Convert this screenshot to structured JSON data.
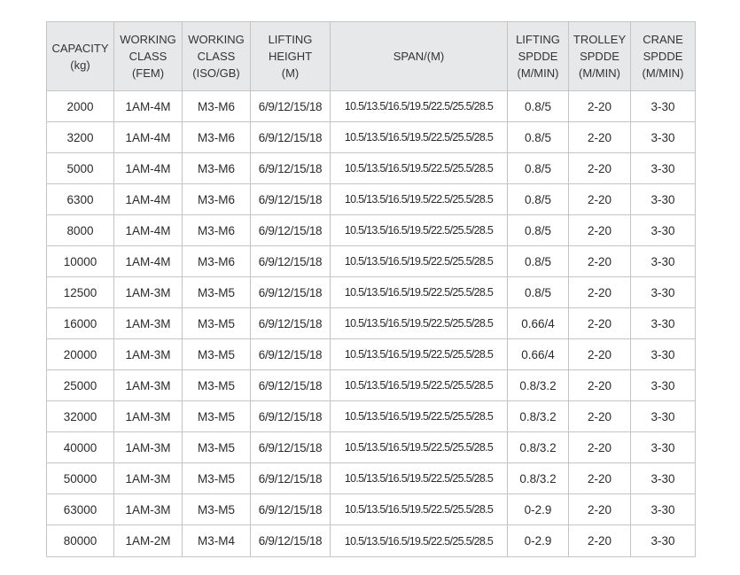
{
  "table": {
    "headers": [
      [
        "CAPACITY",
        "(kg)"
      ],
      [
        "WORKING",
        "CLASS",
        "(FEM)"
      ],
      [
        "WORKING",
        "CLASS",
        "(ISO/GB)"
      ],
      [
        "LIFTING",
        "HEIGHT",
        "(M)"
      ],
      [
        "SPAN/(M)"
      ],
      [
        "LIFTING",
        "SPDDE",
        "(M/MIN)"
      ],
      [
        "TROLLEY",
        "SPDDE",
        "(M/MIN)"
      ],
      [
        "CRANE",
        "SPDDE",
        "(M/MIN)"
      ]
    ],
    "rows": [
      [
        "2000",
        "1AM-4M",
        "M3-M6",
        "6/9/12/15/18",
        "10.5/13.5/16.5/19.5/22.5/25.5/28.5",
        "0.8/5",
        "2-20",
        "3-30"
      ],
      [
        "3200",
        "1AM-4M",
        "M3-M6",
        "6/9/12/15/18",
        "10.5/13.5/16.5/19.5/22.5/25.5/28.5",
        "0.8/5",
        "2-20",
        "3-30"
      ],
      [
        "5000",
        "1AM-4M",
        "M3-M6",
        "6/9/12/15/18",
        "10.5/13.5/16.5/19.5/22.5/25.5/28.5",
        "0.8/5",
        "2-20",
        "3-30"
      ],
      [
        "6300",
        "1AM-4M",
        "M3-M6",
        "6/9/12/15/18",
        "10.5/13.5/16.5/19.5/22.5/25.5/28.5",
        "0.8/5",
        "2-20",
        "3-30"
      ],
      [
        "8000",
        "1AM-4M",
        "M3-M6",
        "6/9/12/15/18",
        "10.5/13.5/16.5/19.5/22.5/25.5/28.5",
        "0.8/5",
        "2-20",
        "3-30"
      ],
      [
        "10000",
        "1AM-4M",
        "M3-M6",
        "6/9/12/15/18",
        "10.5/13.5/16.5/19.5/22.5/25.5/28.5",
        "0.8/5",
        "2-20",
        "3-30"
      ],
      [
        "12500",
        "1AM-3M",
        "M3-M5",
        "6/9/12/15/18",
        "10.5/13.5/16.5/19.5/22.5/25.5/28.5",
        "0.8/5",
        "2-20",
        "3-30"
      ],
      [
        "16000",
        "1AM-3M",
        "M3-M5",
        "6/9/12/15/18",
        "10.5/13.5/16.5/19.5/22.5/25.5/28.5",
        "0.66/4",
        "2-20",
        "3-30"
      ],
      [
        "20000",
        "1AM-3M",
        "M3-M5",
        "6/9/12/15/18",
        "10.5/13.5/16.5/19.5/22.5/25.5/28.5",
        "0.66/4",
        "2-20",
        "3-30"
      ],
      [
        "25000",
        "1AM-3M",
        "M3-M5",
        "6/9/12/15/18",
        "10.5/13.5/16.5/19.5/22.5/25.5/28.5",
        "0.8/3.2",
        "2-20",
        "3-30"
      ],
      [
        "32000",
        "1AM-3M",
        "M3-M5",
        "6/9/12/15/18",
        "10.5/13.5/16.5/19.5/22.5/25.5/28.5",
        "0.8/3.2",
        "2-20",
        "3-30"
      ],
      [
        "40000",
        "1AM-3M",
        "M3-M5",
        "6/9/12/15/18",
        "10.5/13.5/16.5/19.5/22.5/25.5/28.5",
        "0.8/3.2",
        "2-20",
        "3-30"
      ],
      [
        "50000",
        "1AM-3M",
        "M3-M5",
        "6/9/12/15/18",
        "10.5/13.5/16.5/19.5/22.5/25.5/28.5",
        "0.8/3.2",
        "2-20",
        "3-30"
      ],
      [
        "63000",
        "1AM-3M",
        "M3-M5",
        "6/9/12/15/18",
        "10.5/13.5/16.5/19.5/22.5/25.5/28.5",
        "0-2.9",
        "2-20",
        "3-30"
      ],
      [
        "80000",
        "1AM-2M",
        "M3-M4",
        "6/9/12/15/18",
        "10.5/13.5/16.5/19.5/22.5/25.5/28.5",
        "0-2.9",
        "2-20",
        "3-30"
      ]
    ]
  },
  "colors": {
    "header_background": "#e7e8ea",
    "border": "#c4c4c4",
    "text": "#2b2b2b"
  }
}
